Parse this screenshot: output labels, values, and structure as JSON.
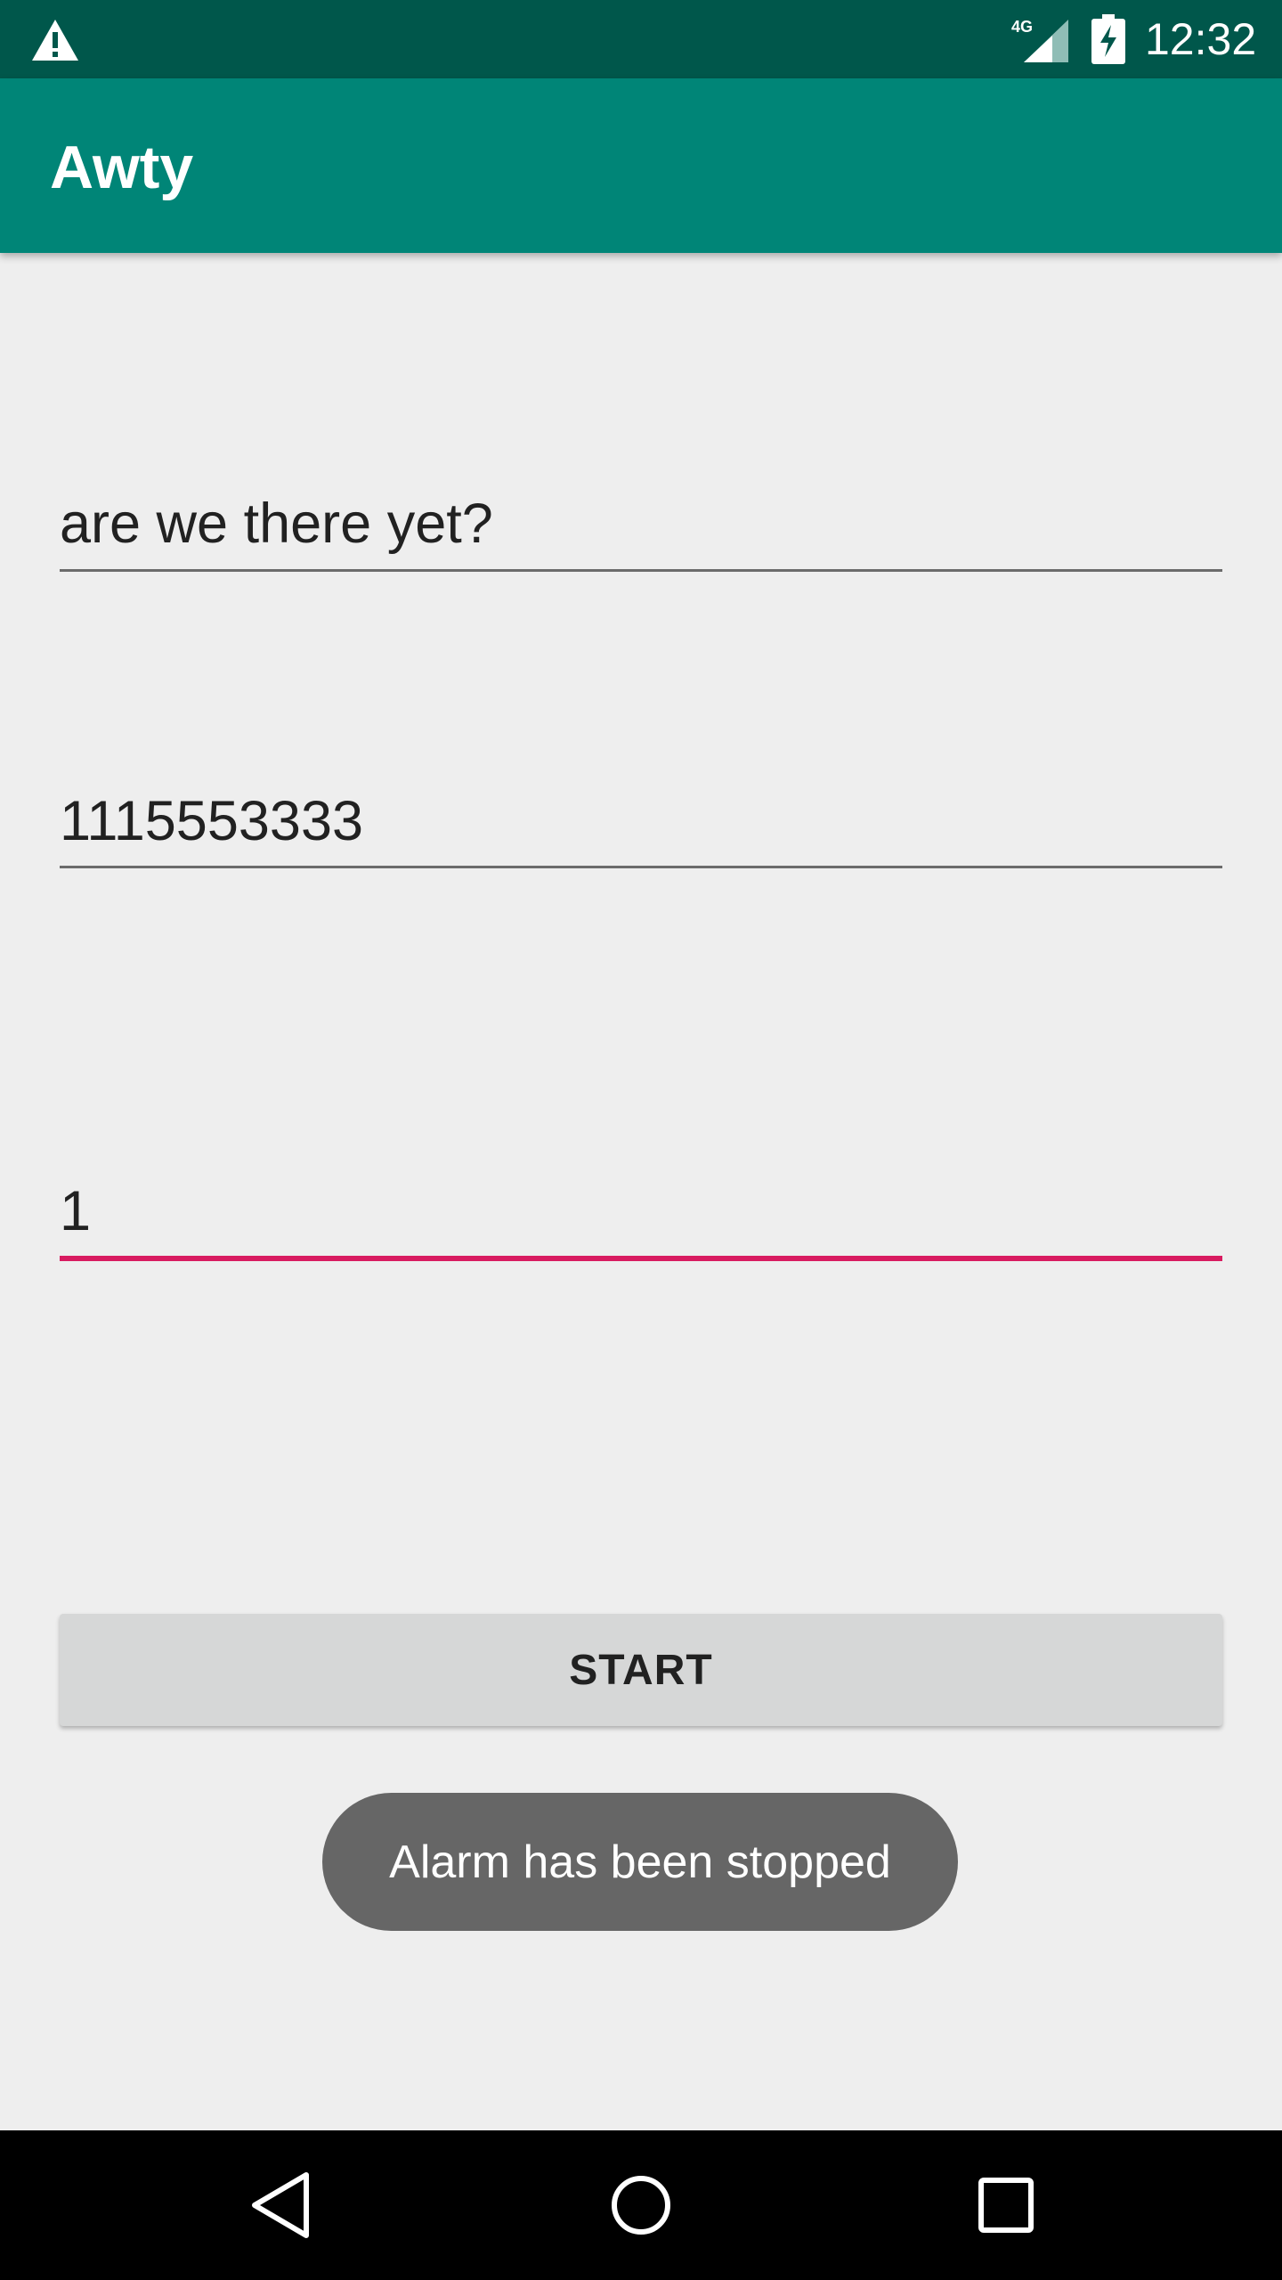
{
  "status_bar": {
    "time": "12:32",
    "network_label": "4G",
    "icons": [
      "alert-icon",
      "signal-icon",
      "battery-charging-icon"
    ]
  },
  "app_bar": {
    "title": "Awty"
  },
  "form": {
    "message_value": "are we there yet?",
    "phone_value": "1115553333",
    "interval_value": "1",
    "start_label": "START"
  },
  "toast": {
    "text": "Alarm has been stopped"
  },
  "nav_bar": {
    "icons": [
      "back-icon",
      "home-icon",
      "recents-icon"
    ]
  },
  "colors": {
    "status_bar": "#00574b",
    "app_bar": "#008577",
    "accent": "#d81b60",
    "background": "#eeeeee",
    "button": "#d6d7d7",
    "toast": "#666666",
    "nav_bar": "#000000"
  }
}
